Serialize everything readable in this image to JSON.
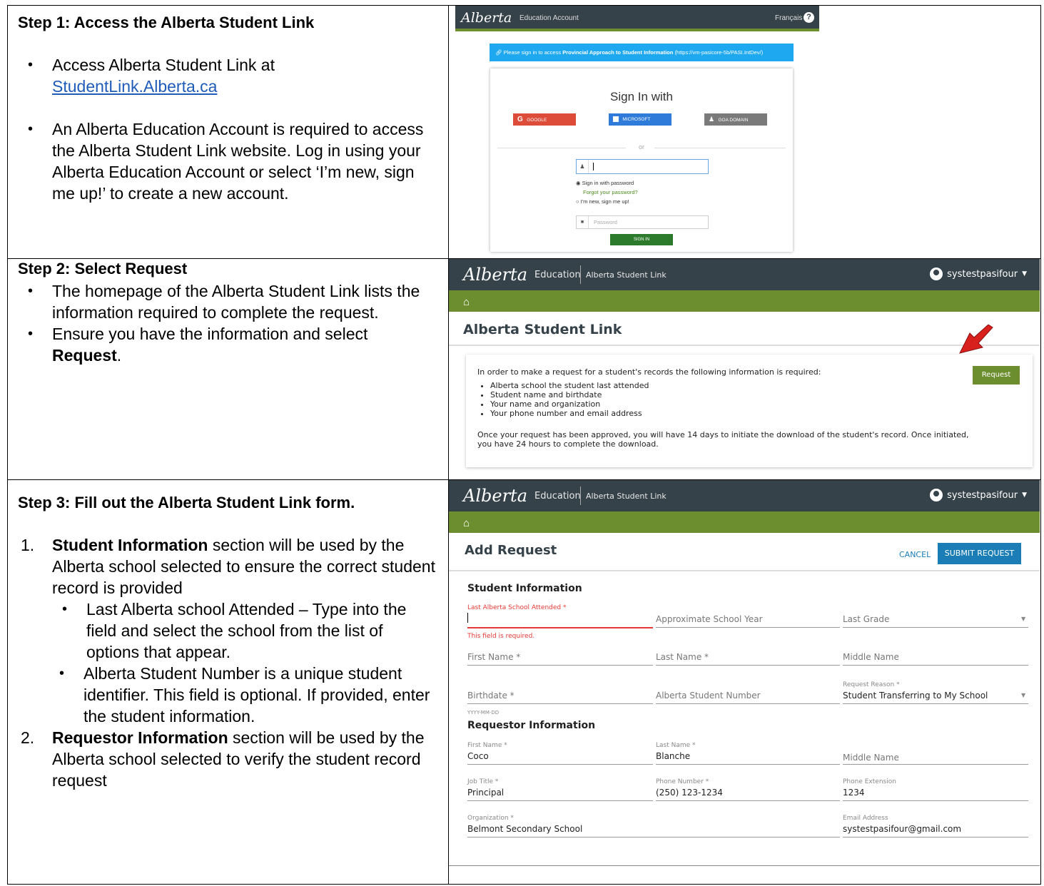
{
  "step1": {
    "title": "Step 1: Access the Alberta Student Link",
    "bullet1_text": "Access Alberta Student Link at",
    "bullet1_link": "StudentLink.Alberta.ca",
    "bullet2": "An Alberta Education Account is required to access the Alberta Student Link website. Log in using your Alberta Education Account or select ‘I’m new, sign me up!’ to create a new account.",
    "shot": {
      "logo": "Alberta",
      "logo_sub": "Education Account",
      "lang": "Français",
      "help": "?",
      "banner_prefix": "Please sign in to access",
      "banner_bold": "Provincial Approach to Student Information",
      "banner_suffix": "(https://vm-pasicore-5b/PASI.IntDev/)",
      "heading": "Sign In with",
      "google": "GOOGLE",
      "microsoft": "MICROSOFT",
      "goa": "GOA DOMAIN",
      "or": "or",
      "opt_password": "Sign in with password",
      "forgot": "Forgot your password?",
      "opt_new": "I'm new, sign me up!",
      "password_placeholder": "Password",
      "signin": "SIGN IN"
    }
  },
  "step2": {
    "title": "Step 2: Select Request",
    "bullet1": "The homepage of the Alberta Student Link lists the information required to complete the request.",
    "bullet2_text": "Ensure you have the information and select",
    "bullet2_bold": "Request",
    "bullet2_end": ".",
    "shot": {
      "logo": "Alberta",
      "education": "Education",
      "app": "Alberta Student Link",
      "user": "systestpasifour",
      "page_title": "Alberta Student Link",
      "intro": "In order to make a request for a student's records the following information is required:",
      "items": [
        "Alberta school the student last attended",
        "Student name and birthdate",
        "Your name and organization",
        "Your phone number and email address"
      ],
      "note": "Once your request has been approved, you will have 14 days to initiate the download of the student's record. Once initiated, you have 24 hours to complete the download.",
      "request_btn": "Request"
    }
  },
  "step3": {
    "title": "Step 3: Fill out the Alberta Student Link form.",
    "item1_bold": "Student Information",
    "item1_text": "section will be used by the Alberta school selected to ensure the correct student record is provided",
    "sub1": "Last Alberta school Attended – Type into the field and select the school from the list of options that appear.",
    "sub2": "Alberta Student Number is a unique student identifier. This field is optional. If provided, enter the student information.",
    "item2_bold": "Requestor Information",
    "item2_text": "section will be used by the Alberta school selected to verify the student record request",
    "num1": "1.",
    "num2": "2.",
    "shot": {
      "logo": "Alberta",
      "education": "Education",
      "app": "Alberta Student Link",
      "user": "systestpasifour",
      "page_title": "Add Request",
      "cancel": "CANCEL",
      "submit": "SUBMIT REQUEST",
      "student_section": "Student Information",
      "last_school_label": "Last Alberta School Attended *",
      "required_error": "This field is required.",
      "approx_year": "Approximate School Year",
      "last_grade": "Last Grade",
      "first_name": "First Name *",
      "last_name": "Last Name *",
      "middle_name": "Middle Name",
      "birthdate": "Birthdate *",
      "date_hint": "YYYY-MM-DD",
      "asn": "Alberta Student Number",
      "reason_label": "Request Reason *",
      "reason_value": "Student Transferring to My School",
      "requestor_section": "Requestor Information",
      "r_first_label": "First Name *",
      "r_first_value": "Coco",
      "r_last_label": "Last Name *",
      "r_last_value": "Blanche",
      "r_middle": "Middle Name",
      "job_label": "Job Title *",
      "job_value": "Principal",
      "phone_label": "Phone Number *",
      "phone_value": "(250) 123-1234",
      "ext_label": "Phone Extension",
      "ext_value": "1234",
      "org_label": "Organization *",
      "org_value": "Belmont Secondary School",
      "email_label": "Email Address",
      "email_value": "systestpasifour@gmail.com"
    }
  },
  "colors": {
    "header": "#36424a",
    "green": "#6d8e2f",
    "blue": "#1a7db6",
    "sky": "#1ea8f0",
    "google": "#dd4b39",
    "microsoft": "#2f7bd9",
    "goa": "#7a7a7a",
    "arrow": "#d8201d"
  }
}
